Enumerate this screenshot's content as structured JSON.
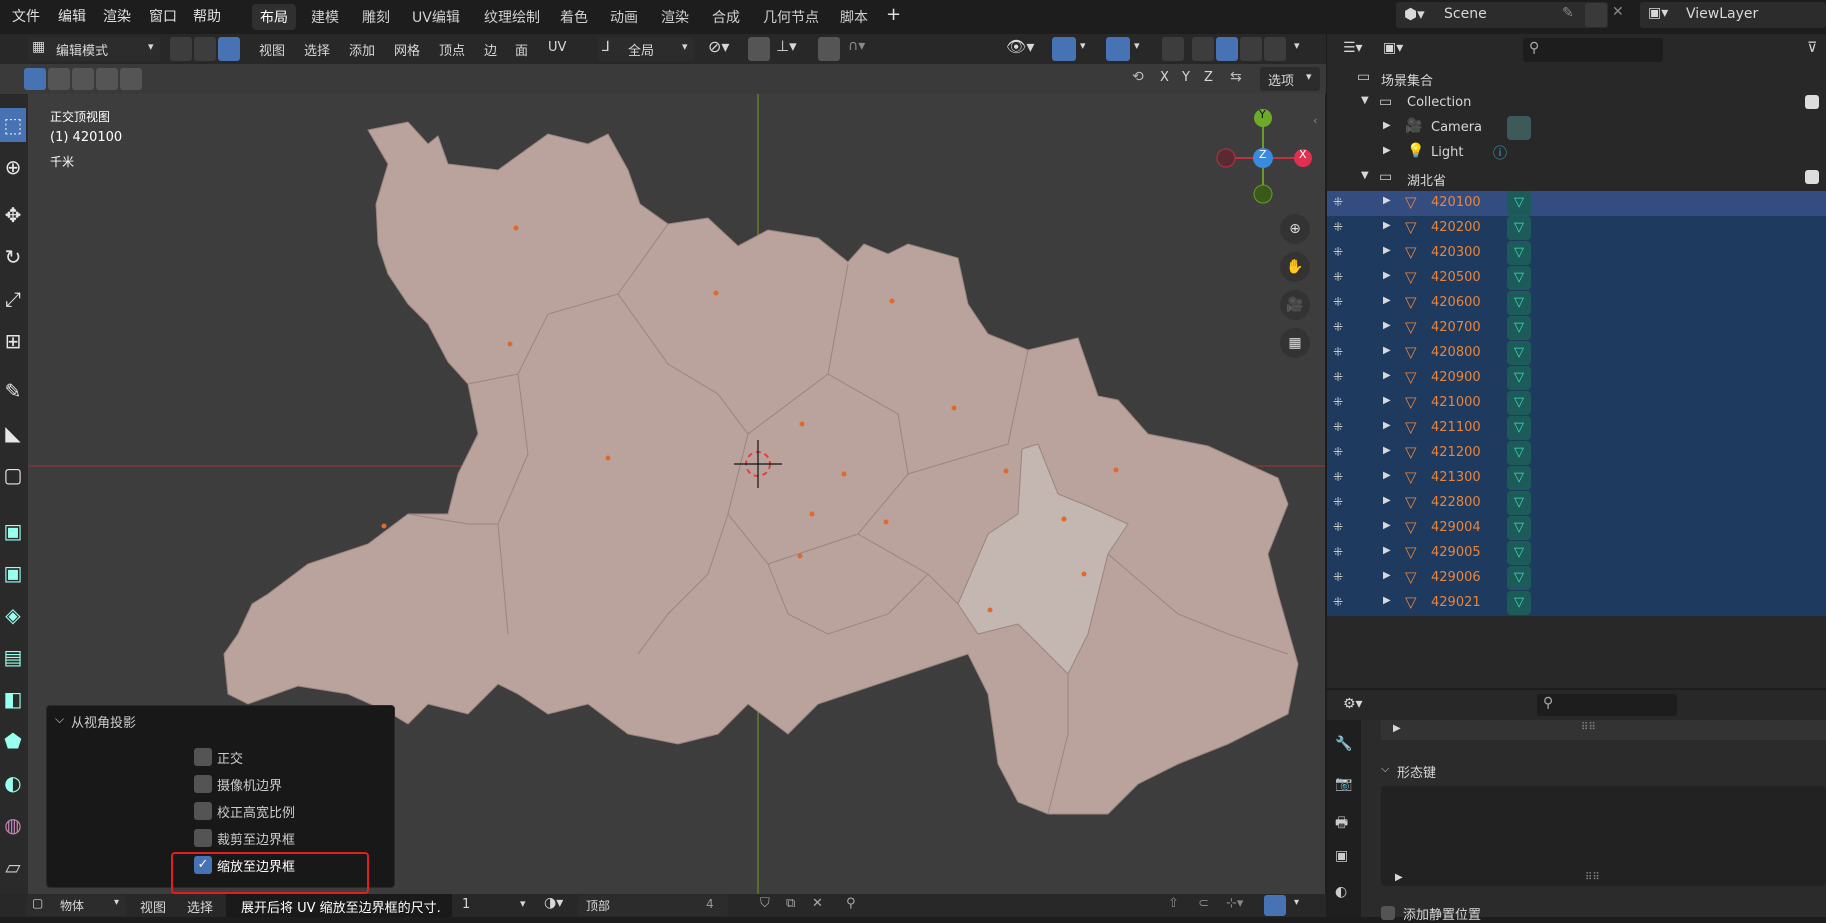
{
  "menu": {
    "file": "文件",
    "edit": "编辑",
    "render": "渲染",
    "window": "窗口",
    "help": "帮助"
  },
  "workspaces": [
    "布局",
    "建模",
    "雕刻",
    "UV编辑",
    "纹理绘制",
    "着色",
    "动画",
    "渲染",
    "合成",
    "几何节点",
    "脚本"
  ],
  "add_workspace": "+",
  "scene": {
    "name": "Scene"
  },
  "view_layer": {
    "name": "ViewLayer"
  },
  "header": {
    "mode": "编辑模式",
    "view": "视图",
    "select": "选择",
    "add": "添加",
    "mesh": "网格",
    "vertex": "顶点",
    "edge": "边",
    "face": "面",
    "uv": "UV",
    "transform": "全局",
    "options": "选项",
    "axis_x": "X",
    "axis_y": "Y",
    "axis_z": "Z"
  },
  "viewport": {
    "view_name": "正交顶视图",
    "object_label": "(1) 420100",
    "units": "千米"
  },
  "gizmo": {
    "y": "Y",
    "z": "Z",
    "x": "X"
  },
  "outliner": {
    "root": "场景集合",
    "collection": "Collection",
    "camera": "Camera",
    "light": "Light",
    "hubei": "湖北省",
    "items": [
      "420100",
      "420200",
      "420300",
      "420500",
      "420600",
      "420700",
      "420800",
      "420900",
      "421000",
      "421100",
      "421200",
      "421300",
      "422800",
      "429004",
      "429005",
      "429006",
      "429021"
    ]
  },
  "properties": {
    "shape_keys": "形态键",
    "add_rest": "添加静置位置"
  },
  "operator_panel": {
    "title": "从视角投影",
    "options": [
      {
        "label": "正交",
        "checked": false
      },
      {
        "label": "摄像机边界",
        "checked": false
      },
      {
        "label": "校正高宽比例",
        "checked": false
      },
      {
        "label": "裁剪至边界框",
        "checked": false
      },
      {
        "label": "缩放至边界框",
        "checked": true
      }
    ]
  },
  "status": {
    "object": "物体",
    "view": "视图",
    "select": "选择",
    "tooltip": "展开后将 UV 缩放至边界框的尺寸.",
    "face_dir": "顶部",
    "count": "4",
    "one": "1"
  },
  "colors": {
    "accent": "#4772b3",
    "selected_text": "#e8853d",
    "highlight_red": "#e02020"
  }
}
